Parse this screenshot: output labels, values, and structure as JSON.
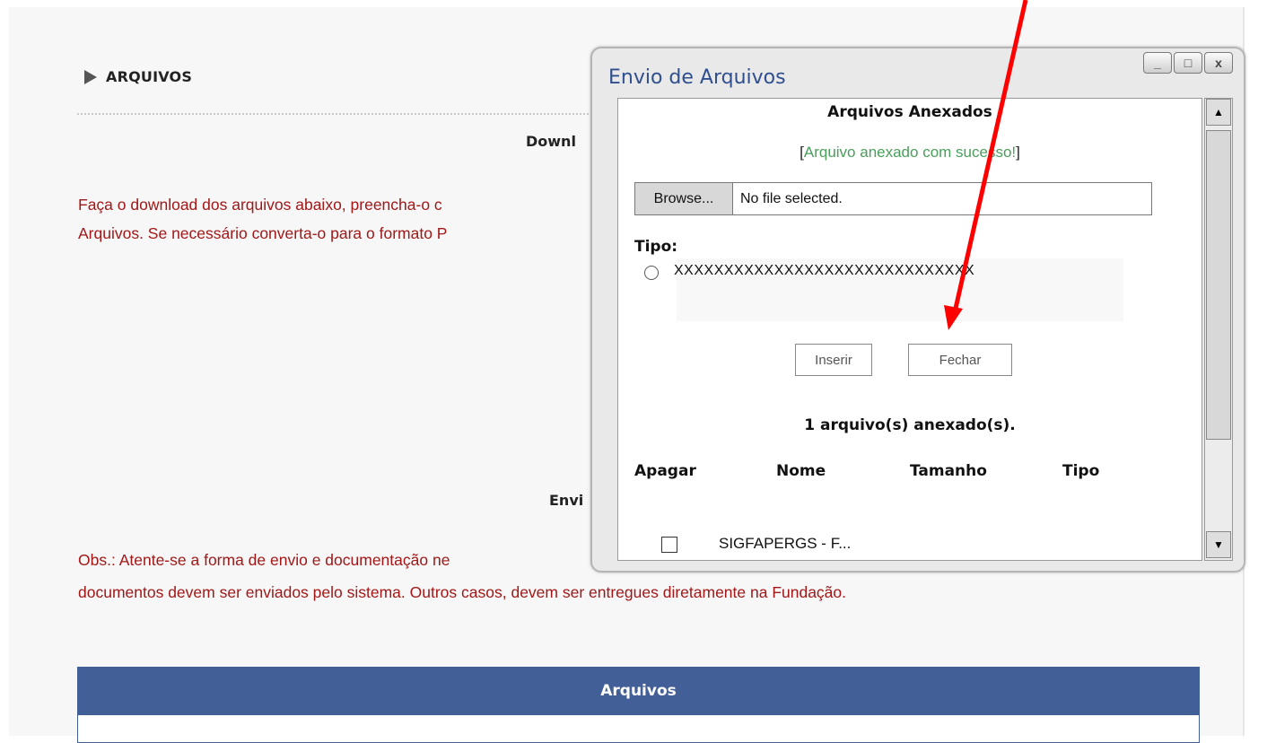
{
  "page": {
    "section_title": "ARQUIVOS",
    "download_heading": "Downl",
    "download_text_line1": "Faça o download dos arquivos abaixo, preencha-o c",
    "download_text_line2": "Arquivos. Se necessário converta-o para o formato P",
    "envio_heading": "Envi",
    "obs_line1": "Obs.: Atente-se a forma de envio e documentação ne",
    "obs_line2": "documentos devem ser enviados pelo sistema. Outros casos, devem ser entregues diretamente na Fundação.",
    "table_header": "Arquivos"
  },
  "dialog": {
    "title": "Envio de Arquivos",
    "window_buttons": {
      "minimize": "_",
      "maximize": "□",
      "close": "x"
    },
    "content_title": "Arquivos Anexados",
    "message_open": "[",
    "message": "Arquivo anexado com sucesso!",
    "message_close": "]",
    "browse_label": "Browse...",
    "file_status": "No file selected.",
    "tipo_label": "Tipo:",
    "tipo_option": "XXXXXXXXXXXXXXXXXXXXXXXXXXXXXX",
    "insert_label": "Inserir",
    "close_label": "Fechar",
    "count_text": "1 arquivo(s) anexado(s).",
    "columns": [
      "Apagar",
      "Nome",
      "Tamanho",
      "Tipo"
    ],
    "rows": [
      {
        "name": "SIGFAPERGS - F..."
      }
    ]
  },
  "colors": {
    "accent_blue": "#435f97",
    "title_blue": "#2f4f8f",
    "red_text": "#a21717",
    "success_green": "#4a9e5c",
    "annotation_red": "#ff0000"
  }
}
